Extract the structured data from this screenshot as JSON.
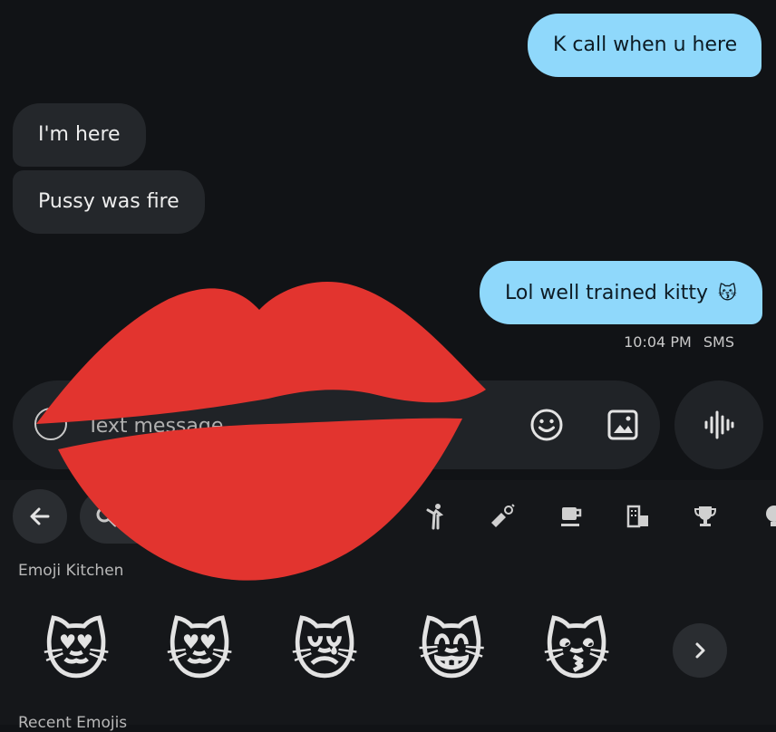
{
  "messages": [
    {
      "text": "K call when u here",
      "direction": "out"
    },
    {
      "text": "I'm here",
      "direction": "in"
    },
    {
      "text": "Pussy was fire",
      "direction": "in"
    },
    {
      "text": "Lol well trained kitty",
      "emoji": "😽",
      "direction": "out"
    }
  ],
  "message_meta": {
    "time": "10:04 PM",
    "channel": "SMS"
  },
  "compose": {
    "placeholder": "Text message"
  },
  "icons": {
    "emoji": "smiley-icon",
    "gallery": "image-icon",
    "voice": "waveform-icon",
    "back": "arrow-left-icon",
    "search": "search-icon",
    "categories": [
      "activity-icon",
      "objects-icon",
      "food-icon",
      "places-icon",
      "trophy-icon",
      "symbols-icon"
    ]
  },
  "emoji_kitchen": {
    "label": "Emoji Kitchen",
    "emojis": [
      "😻",
      "😻",
      "😿",
      "😸",
      "😽"
    ]
  },
  "recent_label": "Recent Emojis",
  "colors": {
    "outgoing_bubble": "#8fd8fb",
    "incoming_bubble": "#24272b",
    "lips": "#e2342f",
    "background": "#111316"
  }
}
